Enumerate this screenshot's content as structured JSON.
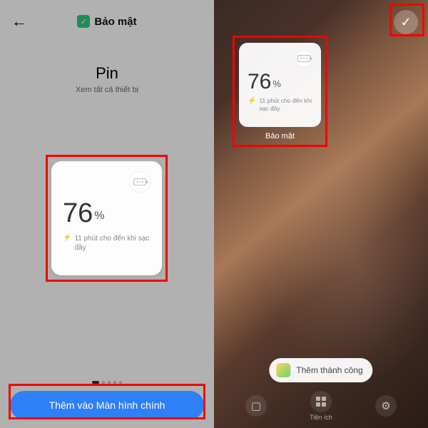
{
  "left": {
    "app_title": "Bảo mật",
    "section_title": "Pin",
    "section_subtitle": "Xem tất cả thiết bị",
    "cta_label": "Thêm vào Màn hình chính"
  },
  "widget": {
    "percent": "76",
    "percent_sign": "%",
    "charging_text": "11 phút cho đến khi sạc đầy"
  },
  "right": {
    "widget_label": "Bảo mật",
    "toast_text": "Thêm thành công",
    "dock": {
      "item2": "Tiện ích"
    }
  }
}
